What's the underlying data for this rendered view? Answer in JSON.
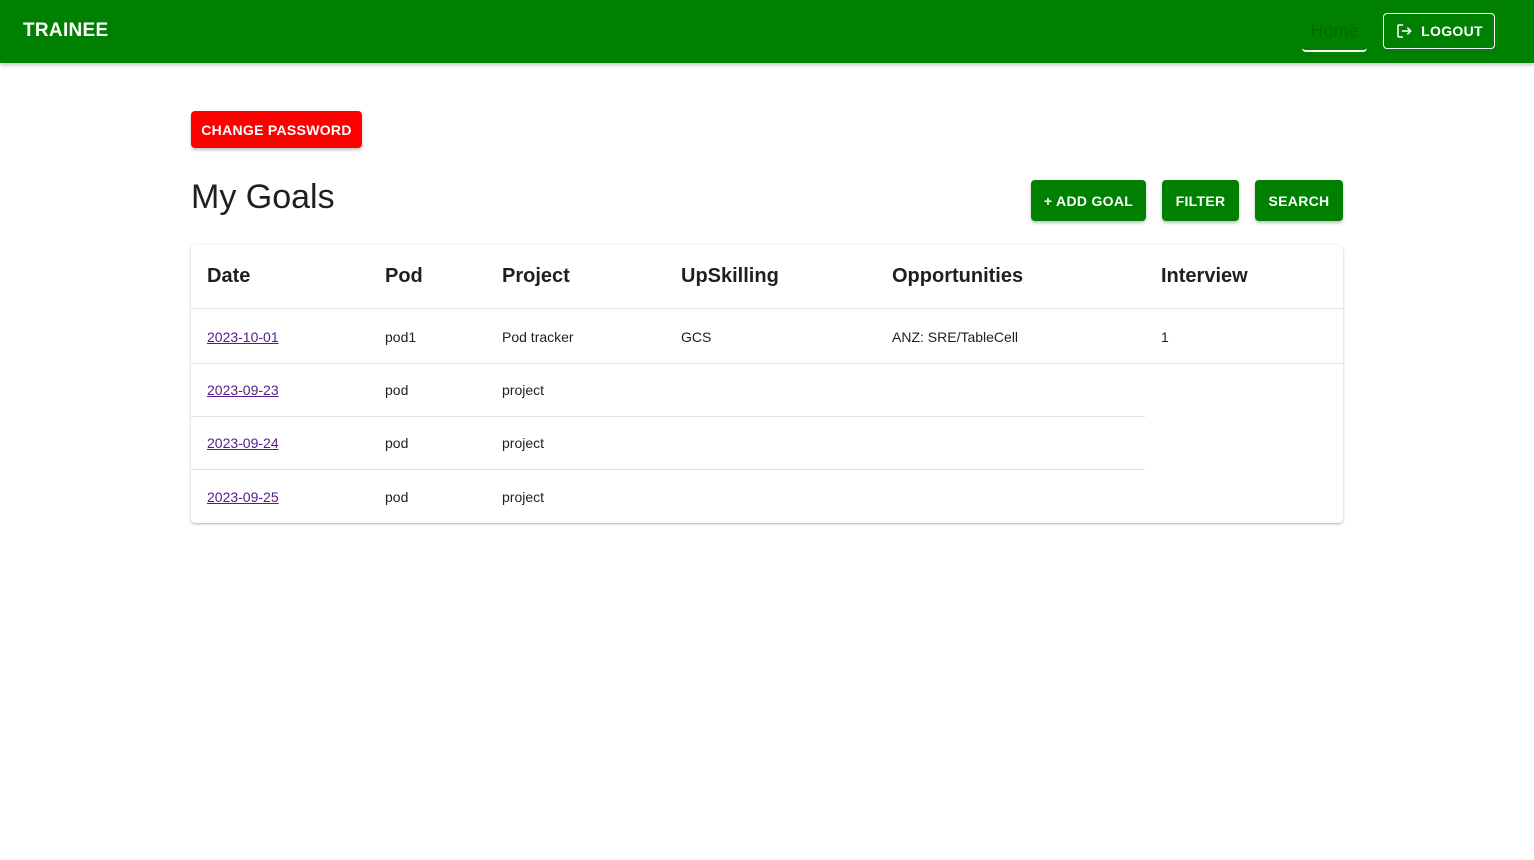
{
  "appbar": {
    "brand": "TRAINEE",
    "nav_home": "Home",
    "logout_label": "LOGOUT"
  },
  "actions": {
    "change_password": "CHANGE PASSWORD",
    "add_goal": "+ ADD GOAL",
    "filter": "FILTER",
    "search": "SEARCH"
  },
  "page": {
    "title": "My Goals"
  },
  "table": {
    "columns": [
      "Date",
      "Pod",
      "Project",
      "UpSkilling",
      "Opportunities",
      "Interview"
    ],
    "rows": [
      {
        "date": "2023-10-01",
        "pod": "pod1",
        "project": "Pod tracker",
        "upskilling": "GCS",
        "opportunities": "ANZ: SRE/TableCell",
        "interview": "1"
      },
      {
        "date": "2023-09-23",
        "pod": "pod",
        "project": "project",
        "upskilling": "",
        "opportunities": "",
        "interview": ""
      },
      {
        "date": "2023-09-24",
        "pod": "pod",
        "project": "project",
        "upskilling": "",
        "opportunities": "",
        "interview": ""
      },
      {
        "date": "2023-09-25",
        "pod": "pod",
        "project": "project",
        "upskilling": "",
        "opportunities": "",
        "interview": ""
      }
    ]
  },
  "colors": {
    "primary": "#008000",
    "danger": "#ff0000",
    "link_visited": "#551a8b"
  },
  "icons": {
    "logout": "logout-icon"
  }
}
